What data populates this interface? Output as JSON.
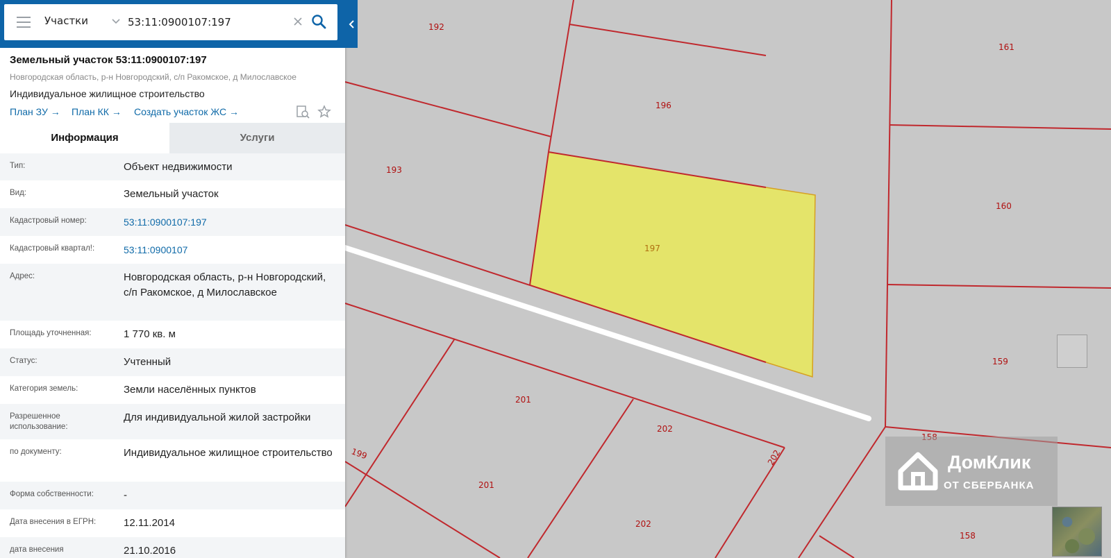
{
  "search": {
    "type_label": "Участки",
    "value": "53:11:0900107:197"
  },
  "object": {
    "title": "Земельный участок 53:11:0900107:197",
    "address": "Новгородская область, р-н Новгородский, с/п Ракомское, д Милославское",
    "usage": "Индивидуальное жилищное строительство"
  },
  "quick_links": [
    {
      "label": "План ЗУ →"
    },
    {
      "label": "План КК →"
    },
    {
      "label": "Создать участок ЖС →"
    }
  ],
  "tabs": [
    {
      "label": "Информация",
      "active": true
    },
    {
      "label": "Услуги",
      "active": false
    }
  ],
  "info_rows": [
    {
      "label": "Тип:",
      "value": "Объект недвижимости"
    },
    {
      "label": "Вид:",
      "value": "Земельный участок"
    },
    {
      "label": "Кадастровый номер:",
      "value": "53:11:0900107:197",
      "link": true
    },
    {
      "label": "Кадастровый квартал!:",
      "value": "53:11:0900107",
      "link": true
    },
    {
      "label": "Адрес:",
      "value": "Новгородская область, р-н Новгородский, с/п Ракомское, д Милославское"
    },
    {
      "label": "Площадь уточненная:",
      "value": "1 770 кв. м"
    },
    {
      "label": "Статус:",
      "value": "Учтенный"
    },
    {
      "label": "Категория земель:",
      "value": "Земли населённых пунктов"
    },
    {
      "label": "Разрешенное использование:",
      "value": "Для индивидуальной жилой застройки"
    },
    {
      "label": "по документу:",
      "value": "Индивидуальное жилищное строительство"
    },
    {
      "label": "Форма собственности:",
      "value": "-"
    },
    {
      "label": "Дата внесения в ЕГРН:",
      "value": "12.11.2014"
    },
    {
      "label": "дата внесения",
      "value": "21.10.2016"
    }
  ],
  "map": {
    "plot_labels": [
      "192",
      "161",
      "196",
      "193",
      "160",
      "197",
      "159",
      "201",
      "202",
      "199",
      "158",
      "202",
      "201",
      "202",
      "158"
    ],
    "selected_label": "197",
    "colors": {
      "background": "#c8c8c8",
      "boundary": "#c0282d",
      "selected_fill": "#e4e46a",
      "road": "#ffffff"
    }
  },
  "watermark": {
    "name": "ДомКлик",
    "subtitle": "ОТ СБЕРБАНКА"
  },
  "icons": [
    "menu-icon",
    "chevron-down-icon",
    "clear-icon",
    "search-icon",
    "chevron-left-icon",
    "document-search-icon",
    "star-icon",
    "domklik-logo-icon"
  ]
}
